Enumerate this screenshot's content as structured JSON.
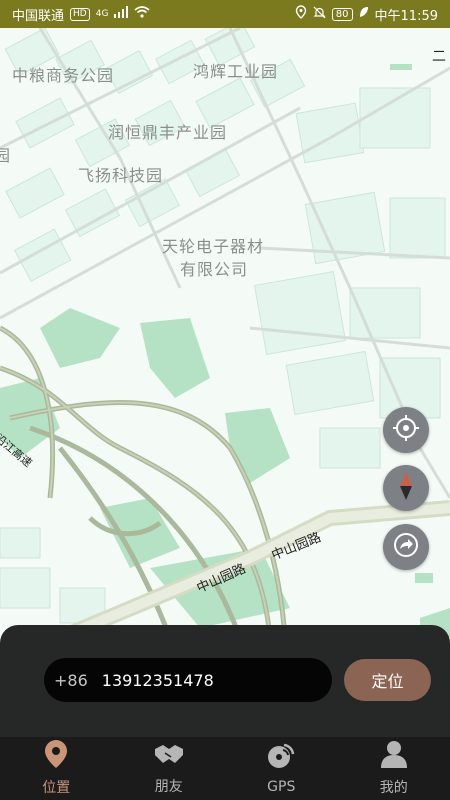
{
  "statusbar": {
    "carrier": "中国联通",
    "hd": "HD",
    "network": "4G",
    "battery": "80",
    "time": "中午11:59"
  },
  "map": {
    "pois": [
      "中粮商务公园",
      "鸿辉工业园",
      "润恒鼎丰产业园",
      "飞扬科技园",
      "天轮电子器材",
      "有限公司",
      "园"
    ],
    "roads": [
      "中山园路",
      "中山园路",
      "沿江高速",
      "二"
    ]
  },
  "controls": {
    "target_icon": "crosshair-icon",
    "compass_icon": "compass-icon",
    "share_icon": "share-icon"
  },
  "search": {
    "prefix": "+86",
    "phone": "13912351478",
    "button": "定位"
  },
  "tabs": [
    {
      "label": "位置",
      "icon": "location-pin-icon",
      "active": true
    },
    {
      "label": "朋友",
      "icon": "handshake-icon",
      "active": false
    },
    {
      "label": "GPS",
      "icon": "gps-signal-icon",
      "active": false
    },
    {
      "label": "我的",
      "icon": "person-icon",
      "active": false
    }
  ],
  "colors": {
    "accent": "#c99578",
    "locate_button": "#8b6453"
  }
}
